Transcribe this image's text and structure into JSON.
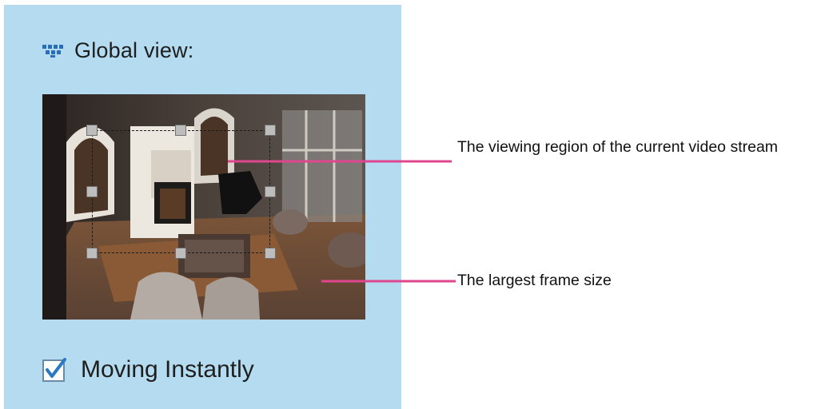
{
  "global_view": {
    "title": "Global view:",
    "icon": "chevron-down-dots-icon"
  },
  "moving_instantly": {
    "label": "Moving Instantly",
    "checked": true
  },
  "annotations": {
    "viewing_region": "The viewing region of the current video stream",
    "largest_frame": "The largest frame size"
  },
  "colors": {
    "panel_background": "#b4dbef",
    "leader_line": "#e0468f",
    "checkmark": "#2a79c3"
  }
}
